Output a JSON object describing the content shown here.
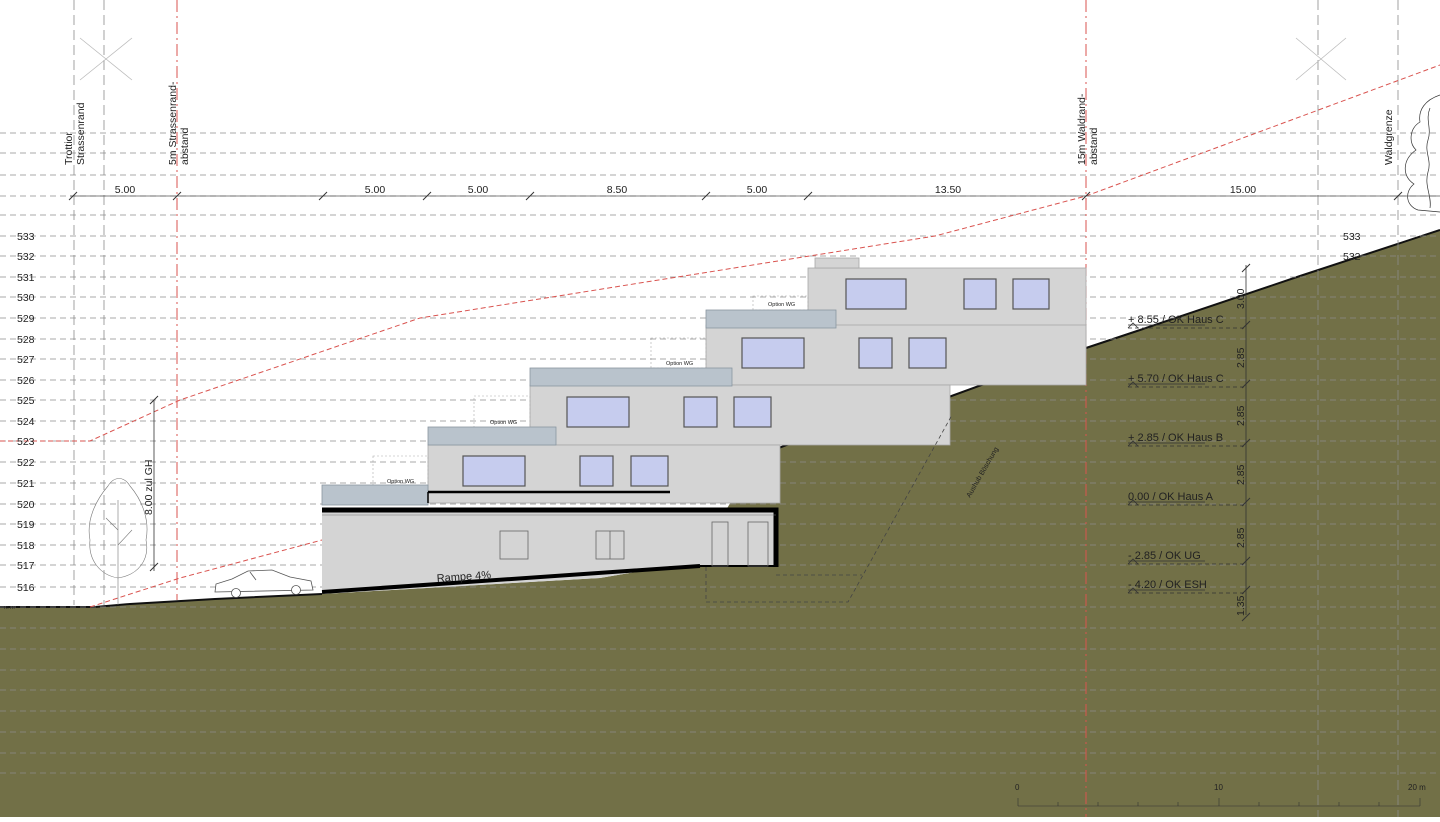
{
  "elevations": [
    "533",
    "532",
    "531",
    "530",
    "529",
    "528",
    "527",
    "526",
    "525",
    "524",
    "523",
    "522",
    "521",
    "520",
    "519",
    "518",
    "517",
    "516"
  ],
  "right_elevations": [
    "533",
    "532"
  ],
  "dimensions_top": [
    "5.00",
    "5.00",
    "5.00",
    "8.50",
    "5.00",
    "13.50",
    "15.00"
  ],
  "vertical_labels": {
    "trottoir": [
      "Trottior",
      "Strassenrand"
    ],
    "strassen_abstand": [
      "5m Strassenrand-",
      "abstand"
    ],
    "waldrand": [
      "15m Waldrand-",
      "abstand"
    ],
    "waldgrenze": [
      "Waldgrenze"
    ],
    "height_limit": "8.00 zul GH",
    "slope": "Aushub Böschung"
  },
  "level_labels": [
    "+ 8.55 / OK Haus C",
    "+ 5.70 / OK Haus C",
    "+ 2.85 / OK Haus B",
    "0.00 / OK Haus A",
    "- 2.85 / OK UG",
    "- 4.20 / OK ESH"
  ],
  "level_dims": [
    "3.00",
    "2.85",
    "2.85",
    "2.85",
    "2.85",
    "1.35"
  ],
  "ramp_label": "Rampe 4%",
  "option_label": "Option WG",
  "scale_bar": [
    "0",
    "10",
    "20 m"
  ],
  "colors": {
    "terrain": "#727047",
    "terrain_line": "#111111",
    "building": "#d4d4d4",
    "building_edge": "#a8a8a8",
    "window": "#c6ccee",
    "terrace": "#b9c3cc",
    "red_line": "#d9534f",
    "grid_line": "#8c8c8c"
  }
}
